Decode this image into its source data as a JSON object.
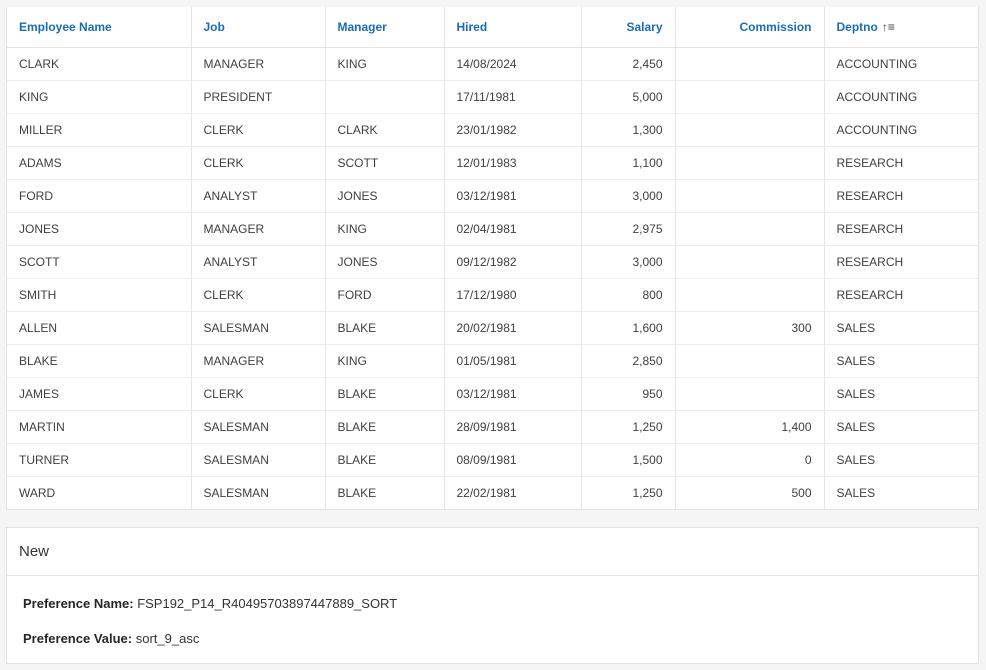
{
  "report": {
    "columns": [
      {
        "key": "name",
        "label": "Employee Name"
      },
      {
        "key": "job",
        "label": "Job"
      },
      {
        "key": "manager",
        "label": "Manager"
      },
      {
        "key": "hired",
        "label": "Hired"
      },
      {
        "key": "salary",
        "label": "Salary"
      },
      {
        "key": "commission",
        "label": "Commission"
      },
      {
        "key": "deptno",
        "label": "Deptno"
      }
    ],
    "rows": [
      {
        "name": "CLARK",
        "job": "MANAGER",
        "manager": "KING",
        "hired": "14/08/2024",
        "salary": "2,450",
        "commission": "",
        "deptno": "ACCOUNTING"
      },
      {
        "name": "KING",
        "job": "PRESIDENT",
        "manager": "",
        "hired": "17/11/1981",
        "salary": "5,000",
        "commission": "",
        "deptno": "ACCOUNTING"
      },
      {
        "name": "MILLER",
        "job": "CLERK",
        "manager": "CLARK",
        "hired": "23/01/1982",
        "salary": "1,300",
        "commission": "",
        "deptno": "ACCOUNTING"
      },
      {
        "name": "ADAMS",
        "job": "CLERK",
        "manager": "SCOTT",
        "hired": "12/01/1983",
        "salary": "1,100",
        "commission": "",
        "deptno": "RESEARCH"
      },
      {
        "name": "FORD",
        "job": "ANALYST",
        "manager": "JONES",
        "hired": "03/12/1981",
        "salary": "3,000",
        "commission": "",
        "deptno": "RESEARCH"
      },
      {
        "name": "JONES",
        "job": "MANAGER",
        "manager": "KING",
        "hired": "02/04/1981",
        "salary": "2,975",
        "commission": "",
        "deptno": "RESEARCH"
      },
      {
        "name": "SCOTT",
        "job": "ANALYST",
        "manager": "JONES",
        "hired": "09/12/1982",
        "salary": "3,000",
        "commission": "",
        "deptno": "RESEARCH"
      },
      {
        "name": "SMITH",
        "job": "CLERK",
        "manager": "FORD",
        "hired": "17/12/1980",
        "salary": "800",
        "commission": "",
        "deptno": "RESEARCH"
      },
      {
        "name": "ALLEN",
        "job": "SALESMAN",
        "manager": "BLAKE",
        "hired": "20/02/1981",
        "salary": "1,600",
        "commission": "300",
        "deptno": "SALES"
      },
      {
        "name": "BLAKE",
        "job": "MANAGER",
        "manager": "KING",
        "hired": "01/05/1981",
        "salary": "2,850",
        "commission": "",
        "deptno": "SALES"
      },
      {
        "name": "JAMES",
        "job": "CLERK",
        "manager": "BLAKE",
        "hired": "03/12/1981",
        "salary": "950",
        "commission": "",
        "deptno": "SALES"
      },
      {
        "name": "MARTIN",
        "job": "SALESMAN",
        "manager": "BLAKE",
        "hired": "28/09/1981",
        "salary": "1,250",
        "commission": "1,400",
        "deptno": "SALES"
      },
      {
        "name": "TURNER",
        "job": "SALESMAN",
        "manager": "BLAKE",
        "hired": "08/09/1981",
        "salary": "1,500",
        "commission": "0",
        "deptno": "SALES"
      },
      {
        "name": "WARD",
        "job": "SALESMAN",
        "manager": "BLAKE",
        "hired": "22/02/1981",
        "salary": "1,250",
        "commission": "500",
        "deptno": "SALES"
      }
    ],
    "sort": {
      "column": "deptno",
      "direction": "asc",
      "icon": "sort-ascending-icon",
      "glyph": "↑≡"
    }
  },
  "new_region": {
    "title": "New",
    "pref_name_label": "Preference Name:",
    "pref_name_value": "FSP192_P14_R40495703897447889_SORT",
    "pref_value_label": "Preference Value:",
    "pref_value_value": "sort_9_asc"
  },
  "colors": {
    "header_link": "#1a6db5",
    "border": "#e2e2e2",
    "background": "#f5f5f5"
  }
}
